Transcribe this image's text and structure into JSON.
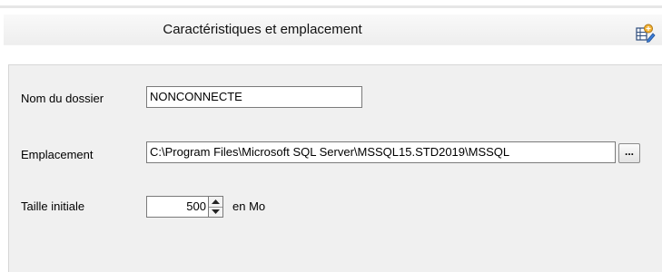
{
  "section": {
    "title": "Caractéristiques et emplacement",
    "icon": "properties-icon"
  },
  "form": {
    "folder_name": {
      "label": "Nom du dossier",
      "value": "NONCONNECTE"
    },
    "location": {
      "label": "Emplacement",
      "value": "C:\\Program Files\\Microsoft SQL Server\\MSSQL15.STD2019\\MSSQL",
      "browse_label": "..."
    },
    "initial_size": {
      "label": "Taille initiale",
      "value": "500",
      "unit": "en Mo"
    }
  },
  "colors": {
    "panel": "#f0f0f0",
    "header": "#eeeeee"
  }
}
